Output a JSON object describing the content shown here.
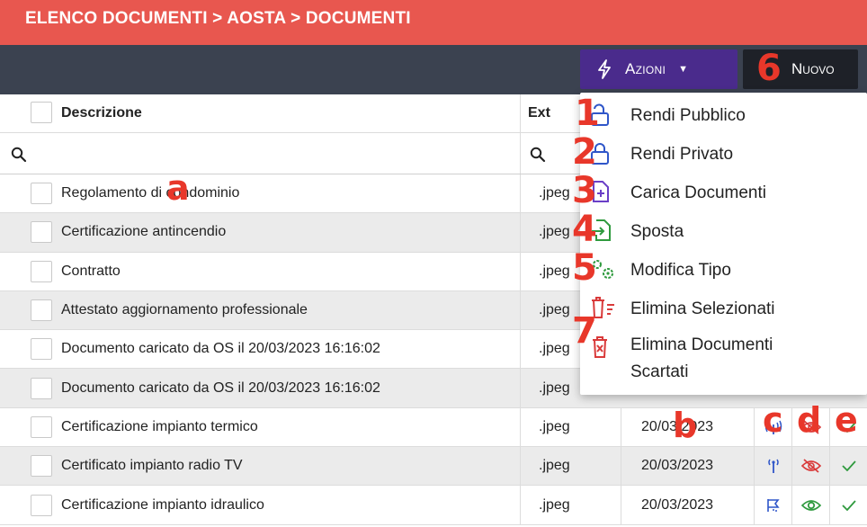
{
  "breadcrumb": "ELENCO DOCUMENTI > AOSTA > DOCUMENTI",
  "toolbar": {
    "azioni_label": "Azioni",
    "nuovo_label": "Nuovo"
  },
  "table": {
    "headers": {
      "descrizione": "Descrizione",
      "ext": "Ext"
    },
    "rows": [
      {
        "descrizione": "Regolamento di condominio",
        "ext": ".jpeg",
        "data": ""
      },
      {
        "descrizione": "Certificazione antincendio",
        "ext": ".jpeg",
        "data": ""
      },
      {
        "descrizione": "Contratto",
        "ext": ".jpeg",
        "data": ""
      },
      {
        "descrizione": "Attestato aggiornamento professionale",
        "ext": ".jpeg",
        "data": ""
      },
      {
        "descrizione": "Documento caricato da OS il 20/03/2023 16:16:02",
        "ext": ".jpeg",
        "data": ""
      },
      {
        "descrizione": "Documento caricato da OS il 20/03/2023 16:16:02",
        "ext": ".jpeg",
        "data": ""
      },
      {
        "descrizione": "Certificazione impianto termico",
        "ext": ".jpeg",
        "data": "20/03/2023"
      },
      {
        "descrizione": "Certificato impianto radio TV",
        "ext": ".jpeg",
        "data": "20/03/2023"
      },
      {
        "descrizione": "Certificazione impianto idraulico",
        "ext": ".jpeg",
        "data": "20/03/2023"
      }
    ]
  },
  "menu": {
    "items": [
      {
        "label": "Rendi Pubblico",
        "icon": "unlock-icon"
      },
      {
        "label": "Rendi Privato",
        "icon": "lock-icon"
      },
      {
        "label": "Carica Documenti",
        "icon": "file-plus-icon"
      },
      {
        "label": "Sposta",
        "icon": "file-move-icon"
      },
      {
        "label": "Modifica Tipo",
        "icon": "gears-icon"
      },
      {
        "label": "Elimina Selezionati",
        "icon": "trash-list-icon"
      },
      {
        "label": "Elimina Documenti",
        "label2": "Scartati",
        "icon": "trash-x-icon"
      }
    ]
  },
  "annotations": {
    "numbers": [
      "1",
      "2",
      "3",
      "4",
      "5",
      "6",
      "7"
    ],
    "letters": [
      "a",
      "b",
      "c",
      "d",
      "e"
    ]
  },
  "colors": {
    "header_red": "#e8574f",
    "toolbar_dark": "#3b4250",
    "azioni_purple": "#4a2b8c",
    "nuovo_black": "#1e2128",
    "annotation_red": "#e8372a",
    "icon_blue": "#2f56c9",
    "icon_purple": "#6a3fc7",
    "icon_green": "#2f9a3e",
    "icon_red": "#d93a3a"
  }
}
